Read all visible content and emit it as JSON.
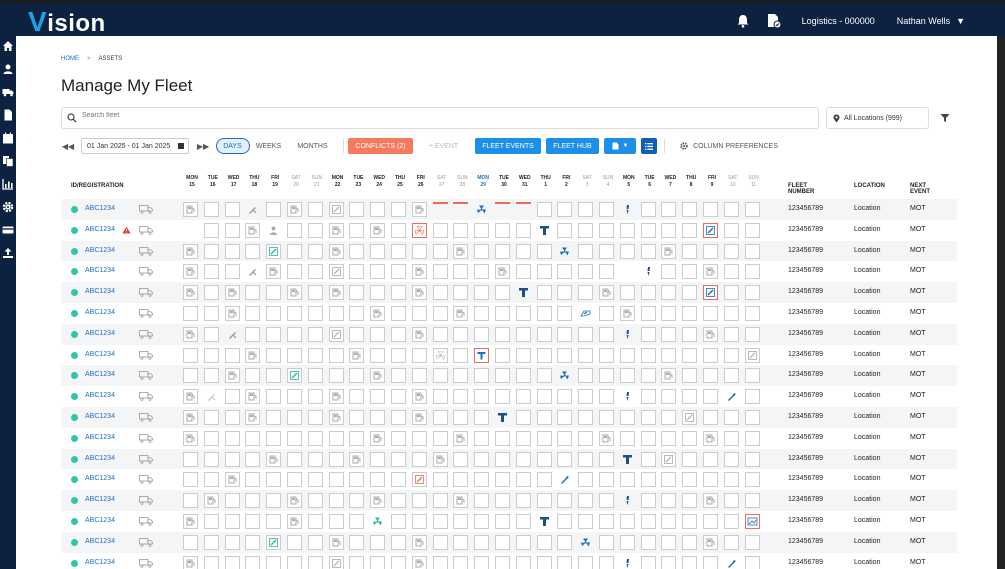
{
  "app": {
    "logo_v": "V",
    "logo_rest": "ision"
  },
  "header": {
    "account": "Logistics - 000000",
    "user": "Nathan Wells"
  },
  "breadcrumb": {
    "home": "HOME",
    "current": "ASSETS"
  },
  "page_title": "Manage My Fleet",
  "search": {
    "placeholder": "Search fleet"
  },
  "location_filter": {
    "value": "All Locations (999)"
  },
  "controls": {
    "date_range": "01 Jan 2025 - 01 Jan 2025",
    "view_days": "DAYS",
    "view_weeks": "WEEKS",
    "view_months": "MONTHS",
    "conflicts": "CONFLICTS (2)",
    "event": "+ EVENT",
    "fleet_events": "FLEET EVENTS",
    "fleet_hub": "FLEET HUB",
    "column_preferences": "COLUMN PREFERENCES"
  },
  "columns": {
    "id": "ID/REGISTRATION",
    "fleet_number": "FLEET NUMBER",
    "location": "LOCATION",
    "next_event": "NEXT EVENT"
  },
  "days": [
    {
      "dow": "MON",
      "n": "15",
      "type": "wd"
    },
    {
      "dow": "TUE",
      "n": "16",
      "type": "wd"
    },
    {
      "dow": "WED",
      "n": "17",
      "type": "wd"
    },
    {
      "dow": "THU",
      "n": "18",
      "type": "wd"
    },
    {
      "dow": "FRI",
      "n": "19",
      "type": "wd"
    },
    {
      "dow": "SAT",
      "n": "20",
      "type": "we"
    },
    {
      "dow": "SUN",
      "n": "21",
      "type": "we"
    },
    {
      "dow": "MON",
      "n": "22",
      "type": "wd"
    },
    {
      "dow": "TUE",
      "n": "23",
      "type": "wd"
    },
    {
      "dow": "WED",
      "n": "24",
      "type": "wd"
    },
    {
      "dow": "THU",
      "n": "25",
      "type": "wd"
    },
    {
      "dow": "FRI",
      "n": "26",
      "type": "wd"
    },
    {
      "dow": "SAT",
      "n": "27",
      "type": "we"
    },
    {
      "dow": "SUN",
      "n": "28",
      "type": "we"
    },
    {
      "dow": "MON",
      "n": "29",
      "type": "today"
    },
    {
      "dow": "TUE",
      "n": "30",
      "type": "wd"
    },
    {
      "dow": "WED",
      "n": "31",
      "type": "wd"
    },
    {
      "dow": "THU",
      "n": "1",
      "type": "wd"
    },
    {
      "dow": "FRI",
      "n": "2",
      "type": "wd"
    },
    {
      "dow": "SAT",
      "n": "3",
      "type": "we"
    },
    {
      "dow": "SUN",
      "n": "4",
      "type": "we"
    },
    {
      "dow": "MON",
      "n": "5",
      "type": "wd"
    },
    {
      "dow": "TUE",
      "n": "6",
      "type": "wd"
    },
    {
      "dow": "WED",
      "n": "7",
      "type": "wd"
    },
    {
      "dow": "THU",
      "n": "8",
      "type": "wd"
    },
    {
      "dow": "FRI",
      "n": "9",
      "type": "wd"
    },
    {
      "dow": "SAT",
      "n": "10",
      "type": "we"
    },
    {
      "dow": "SUN",
      "n": "11",
      "type": "we"
    }
  ],
  "rows": [
    {
      "reg": "ABC1234",
      "warn": false,
      "fleet": "123456789",
      "loc": "Location",
      "next": "MOT",
      "cells": {
        "0": "fuel",
        "3": "tool",
        "5": "fuel",
        "7": "edit",
        "11": "fuel",
        "12": "topred",
        "13": "topred",
        "14": "fan",
        "15": "topred",
        "16": "topred",
        "21": "spark"
      }
    },
    {
      "reg": "ABC1234",
      "warn": true,
      "fleet": "123456789",
      "loc": "Location",
      "next": "MOT",
      "cells": {
        "0": "none",
        "3": "fuel",
        "4": "person",
        "7": "fuel",
        "9": "fuel",
        "11": "fan-red",
        "17": "tyre",
        "25": "edit-red"
      }
    },
    {
      "reg": "ABC1234",
      "warn": false,
      "fleet": "123456789",
      "loc": "Location",
      "next": "MOT",
      "cells": {
        "0": "fuel",
        "4": "edit-teal",
        "7": "fuel",
        "13": "fuel",
        "18": "fan",
        "23": "fuel"
      }
    },
    {
      "reg": "ABC1234",
      "warn": false,
      "fleet": "123456789",
      "loc": "Location",
      "next": "MOT",
      "cells": {
        "0": "fuel",
        "3": "tool",
        "4": "fuel",
        "7": "edit",
        "11": "fuel",
        "15": "fuel",
        "21": "none",
        "22": "spark",
        "25": "fuel"
      }
    },
    {
      "reg": "ABC1234",
      "warn": false,
      "fleet": "123456789",
      "loc": "Location",
      "next": "MOT",
      "cells": {
        "0": "fuel",
        "2": "fuel",
        "5": "fuel",
        "7": "fuel",
        "11": "fuel",
        "16": "tyre",
        "20": "fuel",
        "25": "edit-red"
      }
    },
    {
      "reg": "ABC1234",
      "warn": false,
      "fleet": "123456789",
      "loc": "Location",
      "next": "MOT",
      "cells": {
        "2": "fuel",
        "9": "fuel",
        "13": "fuel",
        "19": "tag",
        "21": "fuel"
      }
    },
    {
      "reg": "ABC1234",
      "warn": false,
      "fleet": "123456789",
      "loc": "Location",
      "next": "MOT",
      "cells": {
        "0": "fuel",
        "2": "tool",
        "7": "edit",
        "11": "fuel",
        "21": "spark",
        "25": "fuel"
      }
    },
    {
      "reg": "ABC1234",
      "warn": false,
      "fleet": "123456789",
      "loc": "Location",
      "next": "MOT",
      "cells": {
        "3": "fuel",
        "8": "fuel",
        "12": "fan-grey",
        "14": "tyre-red",
        "27": "edit"
      }
    },
    {
      "reg": "ABC1234",
      "warn": false,
      "fleet": "123456789",
      "loc": "Location",
      "next": "MOT",
      "cells": {
        "2": "fuel",
        "5": "edit-teal",
        "9": "fuel",
        "18": "fan",
        "23": "fuel"
      }
    },
    {
      "reg": "ABC1234",
      "warn": false,
      "fleet": "123456789",
      "loc": "Location",
      "next": "MOT",
      "cells": {
        "0": "fuel",
        "1": "tool-grey",
        "3": "fuel",
        "7": "fuel",
        "11": "fuel",
        "21": "spark",
        "26": "wrench"
      }
    },
    {
      "reg": "ABC1234",
      "warn": false,
      "fleet": "123456789",
      "loc": "Location",
      "next": "MOT",
      "cells": {
        "0": "fuel",
        "3": "fuel",
        "7": "fuel",
        "11": "fuel",
        "15": "tyre",
        "24": "edit"
      }
    },
    {
      "reg": "ABC1234",
      "warn": false,
      "fleet": "123456789",
      "loc": "Location",
      "next": "MOT",
      "cells": {
        "0": "fuel",
        "9": "fuel",
        "13": "fuel",
        "20": "fuel",
        "25": "fuel"
      }
    },
    {
      "reg": "ABC1234",
      "warn": false,
      "fleet": "123456789",
      "loc": "Location",
      "next": "MOT",
      "cells": {
        "4": "fuel",
        "8": "fuel",
        "12": "fuel",
        "21": "tyre",
        "23": "edit"
      }
    },
    {
      "reg": "ABC1234",
      "warn": false,
      "fleet": "123456789",
      "loc": "Location",
      "next": "MOT",
      "cells": {
        "2": "fuel",
        "11": "edit-orange",
        "18": "wrench"
      }
    },
    {
      "reg": "ABC1234",
      "warn": false,
      "fleet": "123456789",
      "loc": "Location",
      "next": "MOT",
      "cells": {
        "1": "fuel",
        "5": "fuel",
        "9": "fuel",
        "13": "fuel",
        "21": "spark",
        "25": "fuel"
      }
    },
    {
      "reg": "ABC1234",
      "warn": false,
      "fleet": "123456789",
      "loc": "Location",
      "next": "MOT",
      "cells": {
        "0": "fuel",
        "5": "fuel",
        "9": "fan-teal",
        "17": "tyre",
        "27": "img-red"
      }
    },
    {
      "reg": "ABC1234",
      "warn": false,
      "fleet": "123456789",
      "loc": "Location",
      "next": "MOT",
      "cells": {
        "4": "edit-teal",
        "7": "fuel",
        "11": "fuel",
        "19": "fan",
        "25": "fuel"
      }
    },
    {
      "reg": "ABC1234",
      "warn": false,
      "fleet": "123456789",
      "loc": "Location",
      "next": "MOT",
      "cells": {
        "0": "fuel",
        "7": "edit",
        "11": "fuel",
        "21": "spark",
        "26": "wrench"
      }
    }
  ]
}
